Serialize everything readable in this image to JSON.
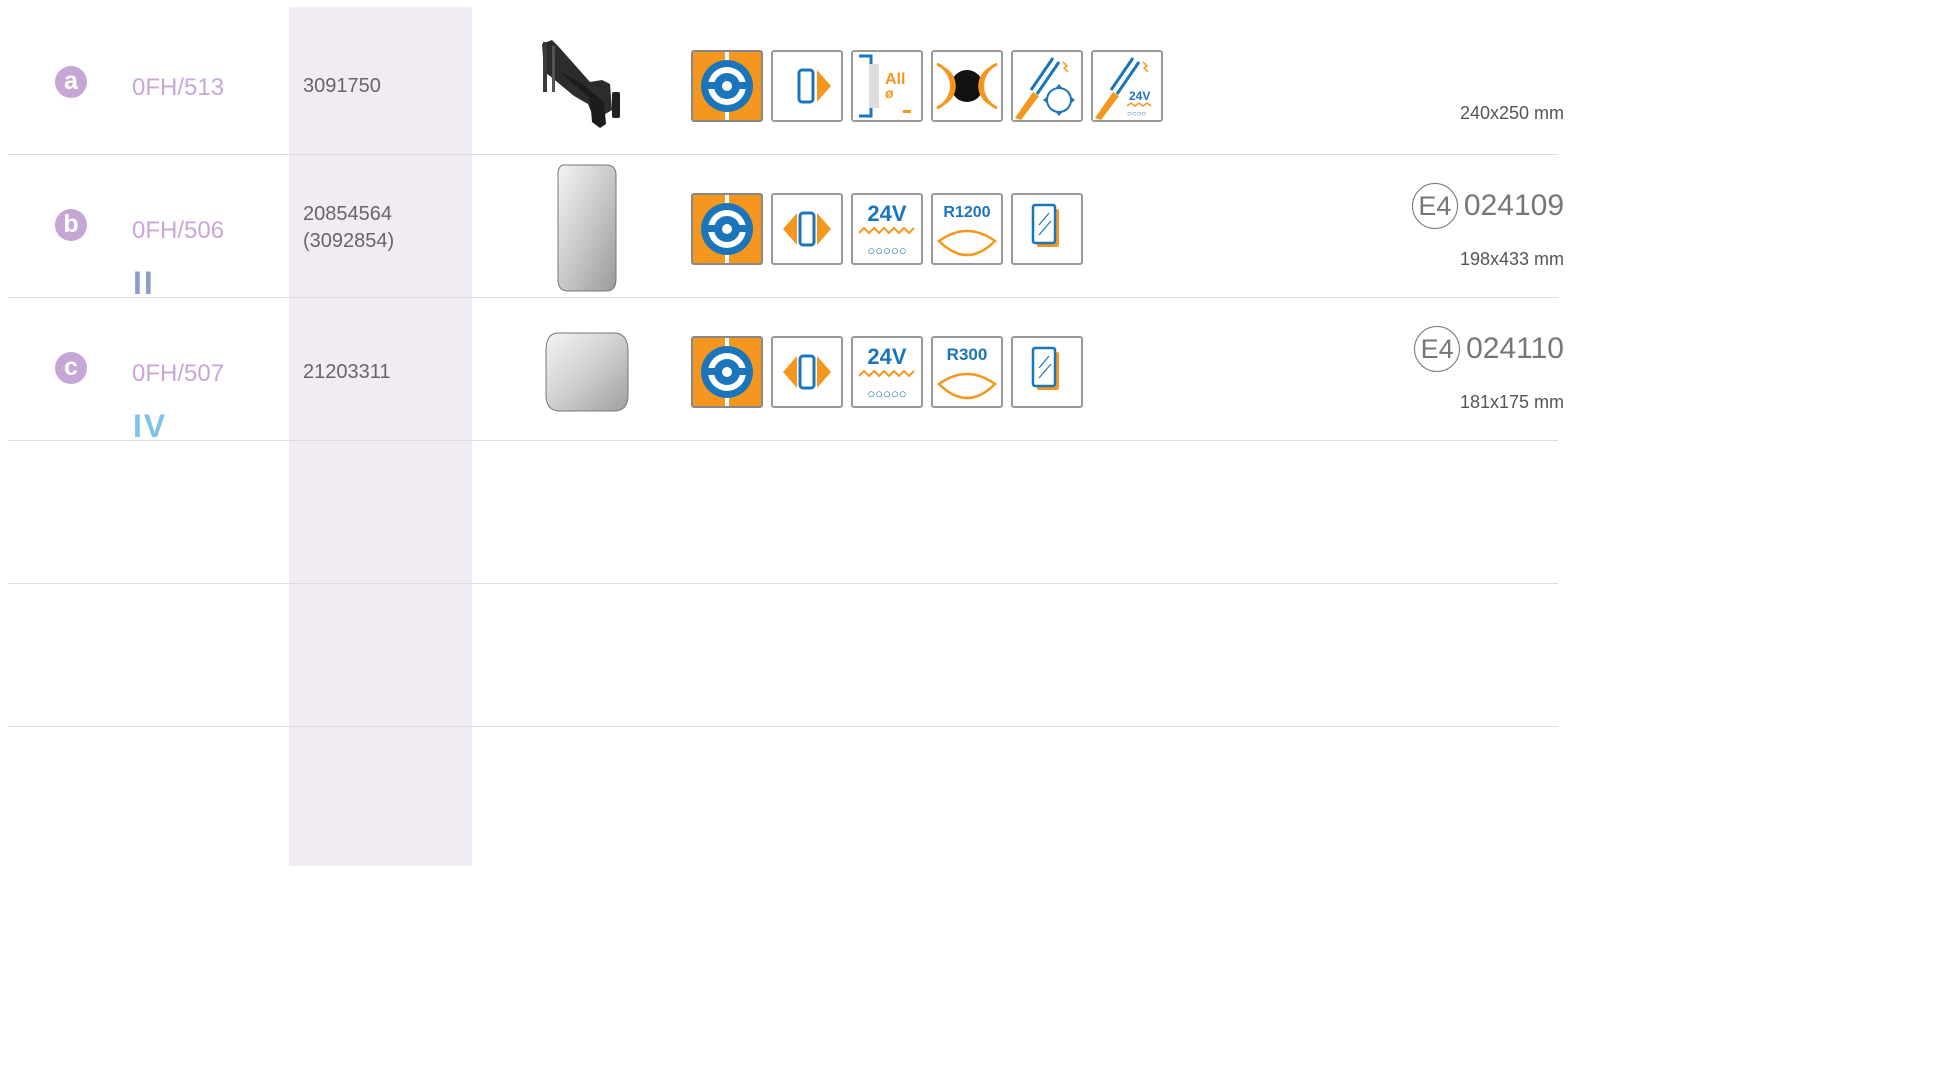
{
  "rows": [
    {
      "badge": "a",
      "code": "0FH/513",
      "ref": "3091750",
      "ref_alt": "",
      "numeral": "",
      "approval_prefix": "",
      "approval_number": "",
      "size": "240x250 mm",
      "icons": [
        "steering-wheel-icon",
        "mirror-arrow-right-icon",
        "all-diameter-icon",
        "mounting-ring-icon",
        "wiring-adjust-icon",
        "wiring-heated-24v-icon"
      ],
      "icon_text": {
        "all": "All",
        "diameter": "ø",
        "heat_voltage": "24V"
      }
    },
    {
      "badge": "b",
      "code": "0FH/506",
      "ref": "20854564",
      "ref_alt": "(3092854)",
      "numeral": "II",
      "numeral_color": "#8a9fc7",
      "approval_prefix": "E4",
      "approval_number": "024109",
      "size": "198x433 mm",
      "icons": [
        "steering-wheel-icon",
        "mirror-double-arrow-icon",
        "heated-24v-icon",
        "radius-r1200-icon",
        "glass-plate-icon"
      ],
      "icon_text": {
        "voltage": "24V",
        "radius": "R1200"
      }
    },
    {
      "badge": "c",
      "code": "0FH/507",
      "ref": "21203311",
      "ref_alt": "",
      "numeral": "IV",
      "numeral_color": "#7ec3e8",
      "approval_prefix": "E4",
      "approval_number": "024110",
      "size": "181x175 mm",
      "icons": [
        "steering-wheel-icon",
        "mirror-double-arrow-icon",
        "heated-24v-icon",
        "radius-r300-icon",
        "glass-plate-icon"
      ],
      "icon_text": {
        "voltage": "24V",
        "radius": "R300"
      }
    }
  ],
  "colors": {
    "accent_orange": "#f5961f",
    "accent_blue": "#1b75bb",
    "badge_purple": "#c5a6d4",
    "band": "#f1ecf4"
  }
}
